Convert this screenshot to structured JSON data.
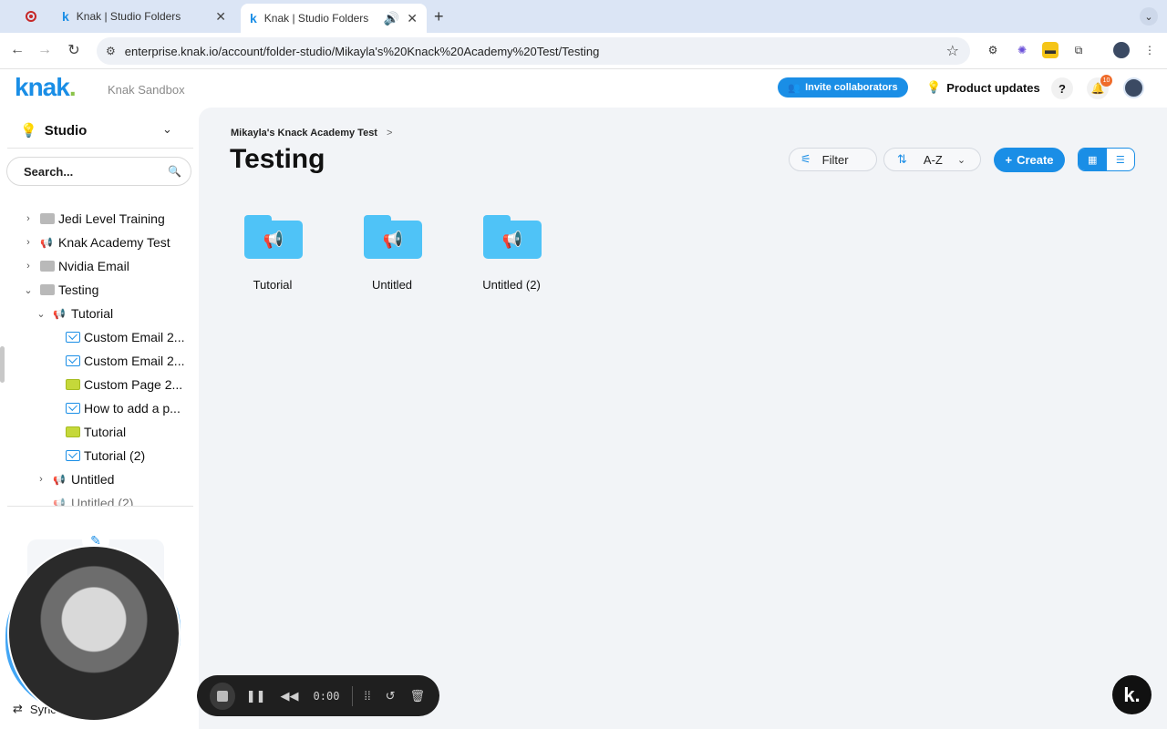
{
  "browser": {
    "tabs": [
      {
        "title": ""
      },
      {
        "title": "Knak | Studio Folders"
      },
      {
        "title": "Knak | Studio Folders"
      }
    ],
    "url": "enterprise.knak.io/account/folder-studio/Mikayla's%20Knack%20Academy%20Test/Testing"
  },
  "header": {
    "logo": "knak",
    "logo_dot": ".",
    "workspace": "Knak Sandbox",
    "invite_label": "Invite collaborators",
    "updates_label": "Product updates",
    "help_label": "?",
    "notification_count": "10"
  },
  "sidebar": {
    "title": "Studio",
    "search_placeholder": "Search...",
    "tree": [
      {
        "label": "Jedi Level Training",
        "icon": "folder-icon",
        "expanded": false
      },
      {
        "label": "Knak Academy Test",
        "icon": "megaphone-icon",
        "expanded": false
      },
      {
        "label": "Nvidia Email",
        "icon": "folder-icon",
        "expanded": false
      },
      {
        "label": "Testing",
        "icon": "folder-icon",
        "expanded": true
      },
      {
        "label": "Tutorial",
        "icon": "megaphone-icon",
        "expanded": true
      },
      {
        "label": "Custom Email 2...",
        "icon": "email-icon"
      },
      {
        "label": "Custom Email 2...",
        "icon": "email-icon"
      },
      {
        "label": "Custom Page 2...",
        "icon": "page-icon"
      },
      {
        "label": "How to add a p...",
        "icon": "email-icon"
      },
      {
        "label": "Tutorial",
        "icon": "page-icon"
      },
      {
        "label": "Tutorial (2)",
        "icon": "email-icon"
      },
      {
        "label": "Untitled",
        "icon": "megaphone-icon",
        "expanded": false
      },
      {
        "label": "Untitled (2)",
        "icon": "megaphone-icon"
      }
    ],
    "sync_label": "Sync"
  },
  "main": {
    "breadcrumb": "Mikayla's Knack Academy Test",
    "breadcrumb_sep": ">",
    "title": "Testing",
    "filter_label": "Filter",
    "sort_label": "A-Z",
    "create_label": "Create",
    "folders": [
      "Tutorial",
      "Untitled",
      "Untitled (2)"
    ]
  },
  "recorder": {
    "time": "0:00"
  },
  "assistant": {
    "label": "k."
  },
  "colors": {
    "accent": "#1a8ee6",
    "folder": "#4fc3f7",
    "logo_dot": "#8bc34a"
  }
}
